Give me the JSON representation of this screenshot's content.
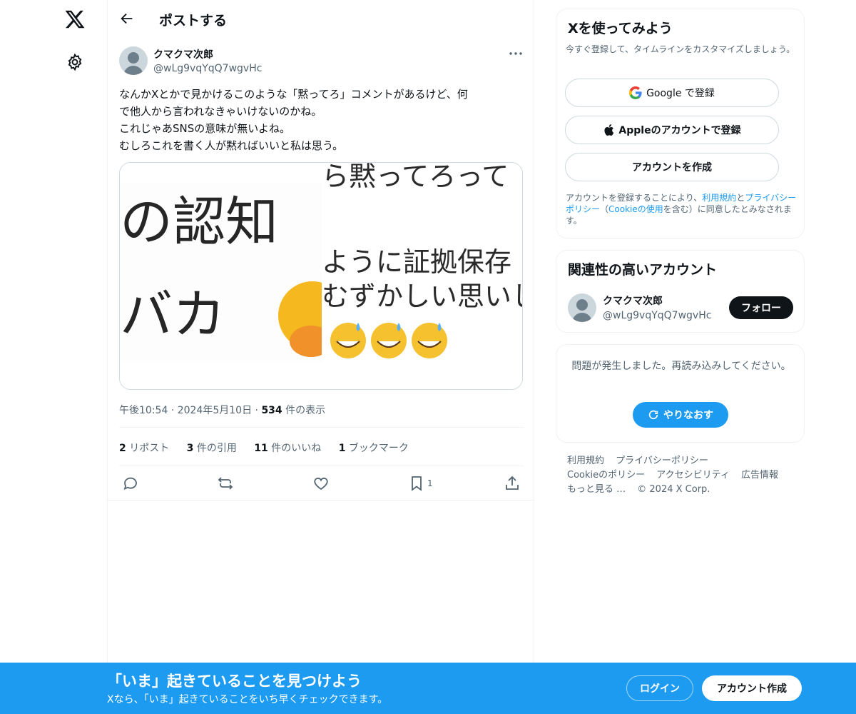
{
  "icons": {
    "logo": "x-logo-icon",
    "settings": "gear-icon",
    "back": "back-arrow-icon",
    "more": "more-dots-icon",
    "reply": "reply-icon",
    "repost": "repost-icon",
    "like": "heart-icon",
    "bookmark": "bookmark-icon",
    "share": "share-icon"
  },
  "header": {
    "title": "ポストする"
  },
  "post": {
    "author": "クマクマ次郎",
    "handle": "@wLg9vqYqQ7wgvHc",
    "lines": [
      "なんかXとかで見かけるこのような「黙ってろ」コメントがあるけど、何",
      "で他人から言われなきゃいけないのかね。",
      "これじゃあSNSの意味が無いよね。",
      "むしろこれを書く人が黙ればいいと私は思う。"
    ],
    "media_left": {
      "line1": "の認知",
      "line2": "バカ"
    },
    "media_right": {
      "line1": "ら黙ってろって",
      "line2": "ように証拠保存",
      "line3": "むずかしい思いし"
    },
    "time": "午後10:54",
    "dot": "·",
    "date": "2024年5月10日",
    "views_count": "534",
    "views_label": "件の表示",
    "stats": {
      "reposts_count": "2",
      "reposts_label": "リポスト",
      "quotes_count": "3",
      "quotes_label": "件の引用",
      "likes_count": "11",
      "likes_label": "件のいいね",
      "bookmarks_count": "1",
      "bookmarks_label": "ブックマーク"
    },
    "bookmark_action_count": "1"
  },
  "signup_card": {
    "title": "Xを使ってみよう",
    "subtitle": "今すぐ登録して、タイムラインをカスタマイズしましょう。",
    "google_label": "Google で登録",
    "apple_label": "Appleのアカウントで登録",
    "create_label": "アカウントを作成",
    "legal_1": "アカウントを登録することにより、",
    "legal_terms": "利用規約",
    "legal_2": "と",
    "legal_privacy": "プライバシーポリシー",
    "legal_3": "（",
    "legal_cookie": "Cookieの使用",
    "legal_4": "を含む）に同意したとみなされます。"
  },
  "related": {
    "title": "関連性の高いアカウント",
    "name": "クマクマ次郎",
    "handle": "@wLg9vqYqQ7wgvHc",
    "follow_label": "フォロー"
  },
  "error_card": {
    "message": "問題が発生しました。再読み込みしてください。",
    "retry_label": "やりなおす"
  },
  "footer": {
    "terms": "利用規約",
    "privacy": "プライバシーポリシー",
    "cookie": "Cookieのポリシー",
    "accessibility": "アクセシビリティ",
    "ads": "広告情報",
    "more": "もっと見る …",
    "copyright": "© 2024 X Corp."
  },
  "banner": {
    "title": "「いま」起きていることを見つけよう",
    "subtitle": "Xなら、「いま」起きていることをいち早くチェックできます。",
    "login_label": "ログイン",
    "signup_label": "アカウント作成"
  },
  "colors": {
    "accent": "#1d9bf0",
    "text": "#0f1419",
    "muted": "#536471",
    "border": "#eff3f4"
  }
}
